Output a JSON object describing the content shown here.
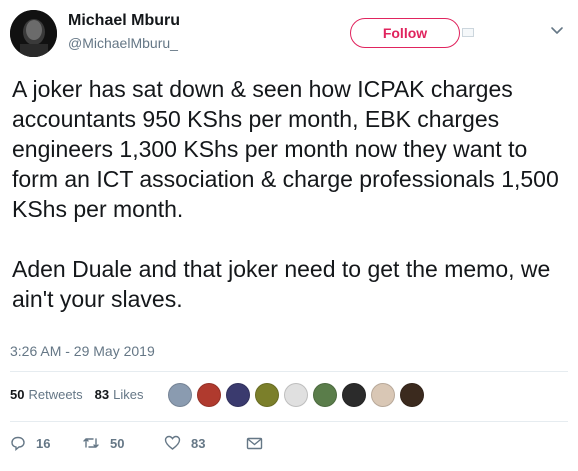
{
  "tweet": {
    "author": {
      "name": "Michael Mburu",
      "handle": "@MichaelMburu_"
    },
    "follow_label": "Follow",
    "text": "A joker has sat down & seen how ICPAK charges accountants 950 KShs per month, EBK charges engineers 1,300 KShs per month now they want to form an ICT association & charge professionals 1,500 KShs per month.\n\nAden Duale and that joker need to get the memo, we ain't your slaves.",
    "timestamp": "3:26 AM - 29 May 2019",
    "stats": {
      "retweets_count": "50",
      "retweets_label": "Retweets",
      "likes_count": "83",
      "likes_label": "Likes"
    },
    "actions": {
      "reply_count": "16",
      "retweet_count": "50",
      "like_count": "83"
    }
  },
  "colors": {
    "follow_accent": "#e0245e",
    "secondary_text": "#657786",
    "divider": "#e6ecf0"
  },
  "likers": [
    {
      "avatar": "liker-avatar-1",
      "color": "#8a9bb0"
    },
    {
      "avatar": "liker-avatar-2",
      "color": "#b03a2e"
    },
    {
      "avatar": "liker-avatar-3",
      "color": "#3a3a6e"
    },
    {
      "avatar": "liker-avatar-4",
      "color": "#7b7f2a"
    },
    {
      "avatar": "liker-avatar-5",
      "color": "#e0e0e0"
    },
    {
      "avatar": "liker-avatar-6",
      "color": "#5a7d4a"
    },
    {
      "avatar": "liker-avatar-7",
      "color": "#2b2b2b"
    },
    {
      "avatar": "liker-avatar-8",
      "color": "#d9c7b5"
    },
    {
      "avatar": "liker-avatar-9",
      "color": "#3b2a1e"
    }
  ]
}
